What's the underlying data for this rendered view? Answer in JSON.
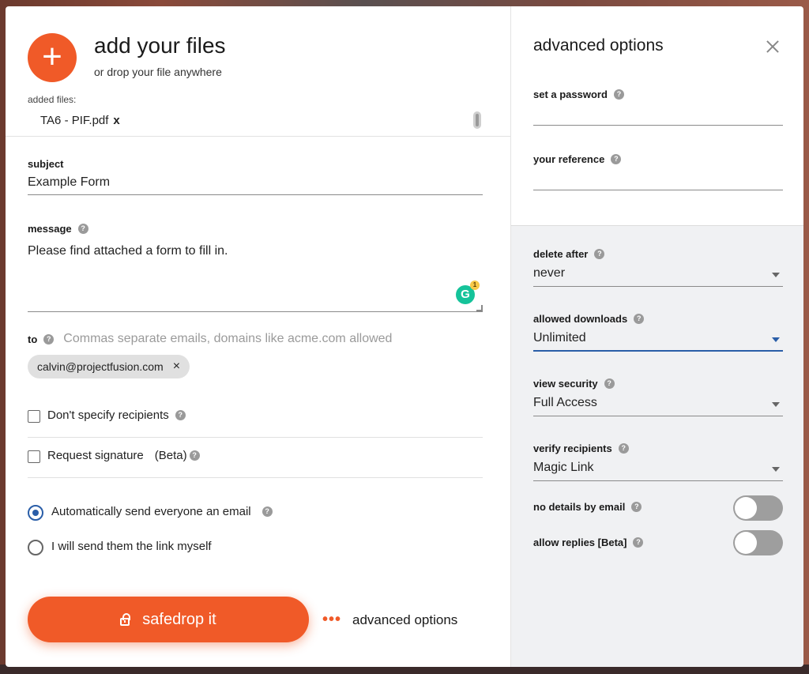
{
  "upload": {
    "add_icon": "+",
    "title": "add your files",
    "subtitle": "or drop your file anywhere",
    "added_label": "added files:",
    "files": [
      {
        "name": "TA6 - PIF.pdf",
        "remove": "x"
      }
    ]
  },
  "subject": {
    "label": "subject",
    "value": "Example Form"
  },
  "message": {
    "label": "message",
    "value": "Please find attached a form to fill in.",
    "grammarly_icon": "G",
    "grammarly_count": "1"
  },
  "to": {
    "label": "to",
    "placeholder": "Commas separate emails, domains like acme.com allowed",
    "recipients": [
      {
        "email": "calvin@projectfusion.com",
        "remove": "×"
      }
    ]
  },
  "options": {
    "dont_specify": {
      "label": "Don't specify recipients",
      "checked": false
    },
    "request_signature": {
      "label": "Request signature",
      "beta": "(Beta)",
      "checked": false
    }
  },
  "send_mode": {
    "auto": {
      "label": "Automatically send everyone an email",
      "selected": true
    },
    "manual": {
      "label": "I will send them the link myself",
      "selected": false
    }
  },
  "actions": {
    "send_label": "safedrop it",
    "advanced_dots": "•••",
    "advanced_label": "advanced options"
  },
  "advanced": {
    "title": "advanced options",
    "password_label": "set a password",
    "reference_label": "your reference",
    "delete_after": {
      "label": "delete after",
      "value": "never"
    },
    "allowed_downloads": {
      "label": "allowed downloads",
      "value": "Unlimited"
    },
    "view_security": {
      "label": "view security",
      "value": "Full Access"
    },
    "verify_recipients": {
      "label": "verify recipients",
      "value": "Magic Link"
    },
    "no_details": {
      "label": "no details by email",
      "on": false
    },
    "allow_replies": {
      "label": "allow replies [Beta]",
      "on": false
    }
  },
  "help_glyph": "?",
  "colors": {
    "accent": "#f05a28",
    "selected_blue": "#2a5ea8",
    "grammarly": "#15c39a"
  }
}
